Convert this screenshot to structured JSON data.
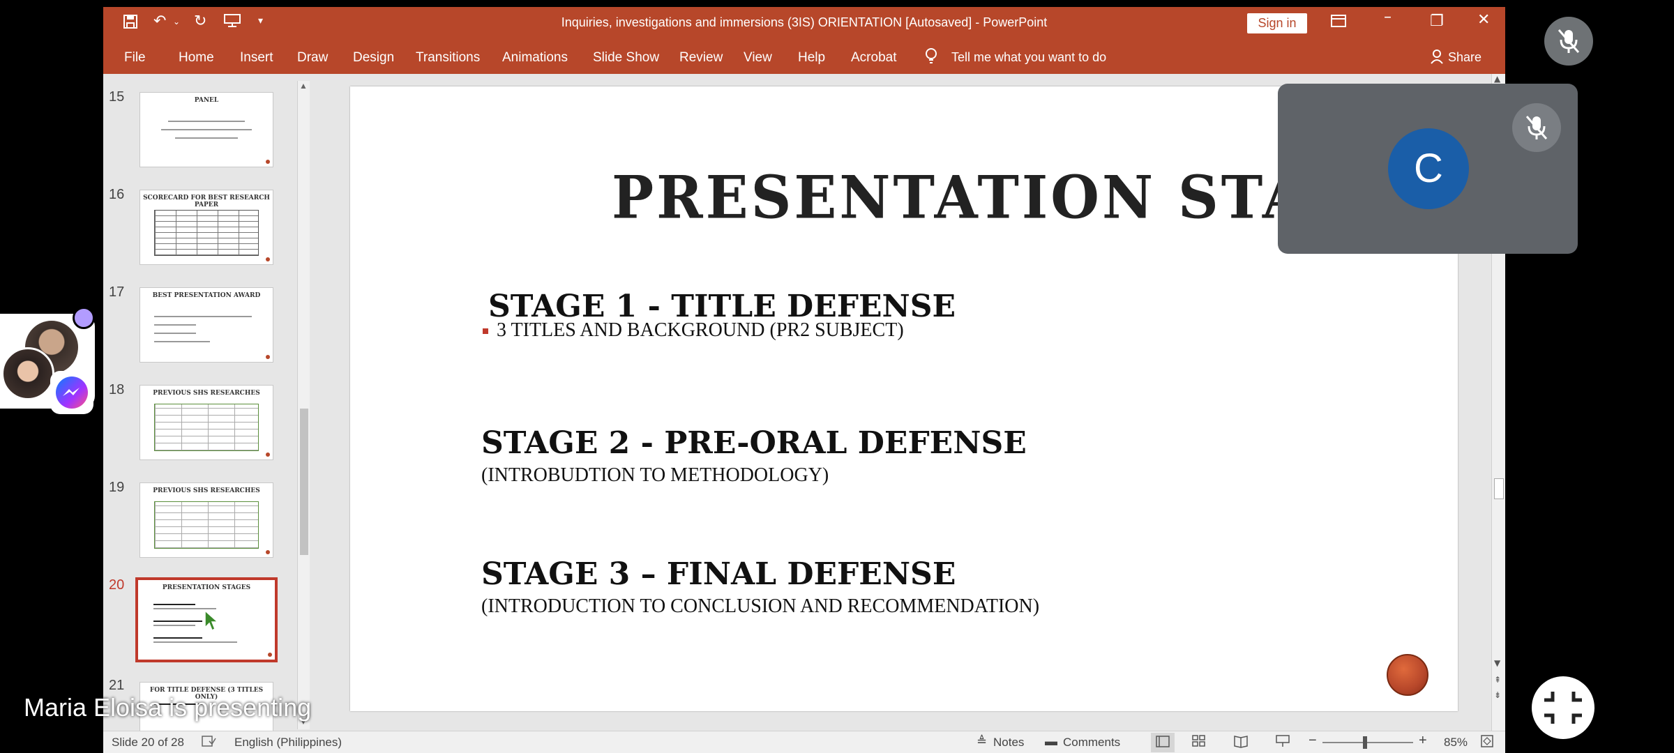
{
  "window": {
    "doc_title": "Inquiries, investigations and immersions (3IS) ORIENTATION [Autosaved]  -  PowerPoint",
    "sign_in": "Sign in"
  },
  "ribbon": {
    "tabs": [
      "File",
      "Home",
      "Insert",
      "Draw",
      "Design",
      "Transitions",
      "Animations",
      "Slide Show",
      "Review",
      "View",
      "Help",
      "Acrobat"
    ],
    "tell_me": "Tell me what you want to do",
    "share": "Share"
  },
  "thumbnails": [
    {
      "num": "15",
      "title": "PANEL"
    },
    {
      "num": "16",
      "title": "SCORECARD FOR BEST RESEARCH PAPER"
    },
    {
      "num": "17",
      "title": "BEST PRESENTATION AWARD"
    },
    {
      "num": "18",
      "title": "PREVIOUS SHS RESEARCHES"
    },
    {
      "num": "19",
      "title": "PREVIOUS SHS RESEARCHES"
    },
    {
      "num": "20",
      "title": "PRESENTATION STAGES"
    },
    {
      "num": "21",
      "title": "FOR TITLE DEFENSE (3 TITLES ONLY)"
    }
  ],
  "slide": {
    "title": "PRESENTATION  STAGES",
    "stage1_heading": "STAGE 1 - TITLE DEFENSE",
    "stage1_bullet": "3 TITLES AND BACKGROUND (PR2 SUBJECT)",
    "stage2_heading": "STAGE 2 -  PRE-ORAL DEFENSE",
    "stage2_sub": "(INTROBUDTION TO METHODOLOGY)",
    "stage3_heading": "STAGE 3 – FINAL DEFENSE",
    "stage3_sub": "(INTRODUCTION TO CONCLUSION AND RECOMMENDATION)"
  },
  "status": {
    "slide_info": "Slide 20 of 28",
    "language": "English (Philippines)",
    "notes": "Notes",
    "comments": "Comments",
    "zoom": "85%"
  },
  "meeting": {
    "presenting_text": "Maria Eloisa is presenting",
    "participant_initial": "C"
  },
  "colors": {
    "ppt_accent": "#b7472a",
    "avatar_blue": "#1a5ea8",
    "tile_gray": "#5f6368"
  }
}
